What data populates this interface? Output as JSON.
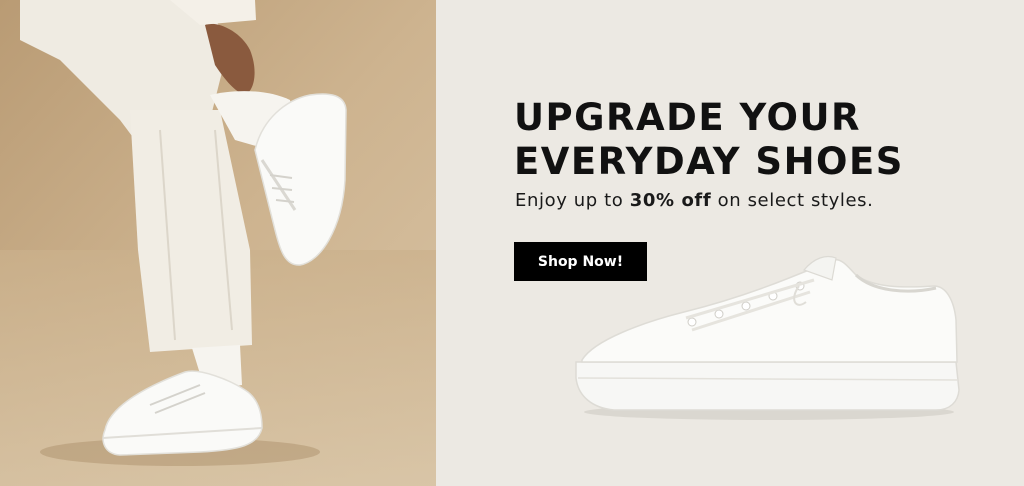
{
  "promo": {
    "headline_line1": "UPGRADE YOUR",
    "headline_line2": "EVERYDAY SHOES",
    "subline_prefix": "Enjoy up to ",
    "subline_highlight": "30% off",
    "subline_suffix": " on select styles.",
    "cta_label": "Shop Now!"
  },
  "colors": {
    "photo_background": "#C6AC88",
    "promo_background": "#ECE9E3",
    "button_background": "#000000",
    "button_text": "#FFFFFF",
    "headline_text": "#111111"
  }
}
